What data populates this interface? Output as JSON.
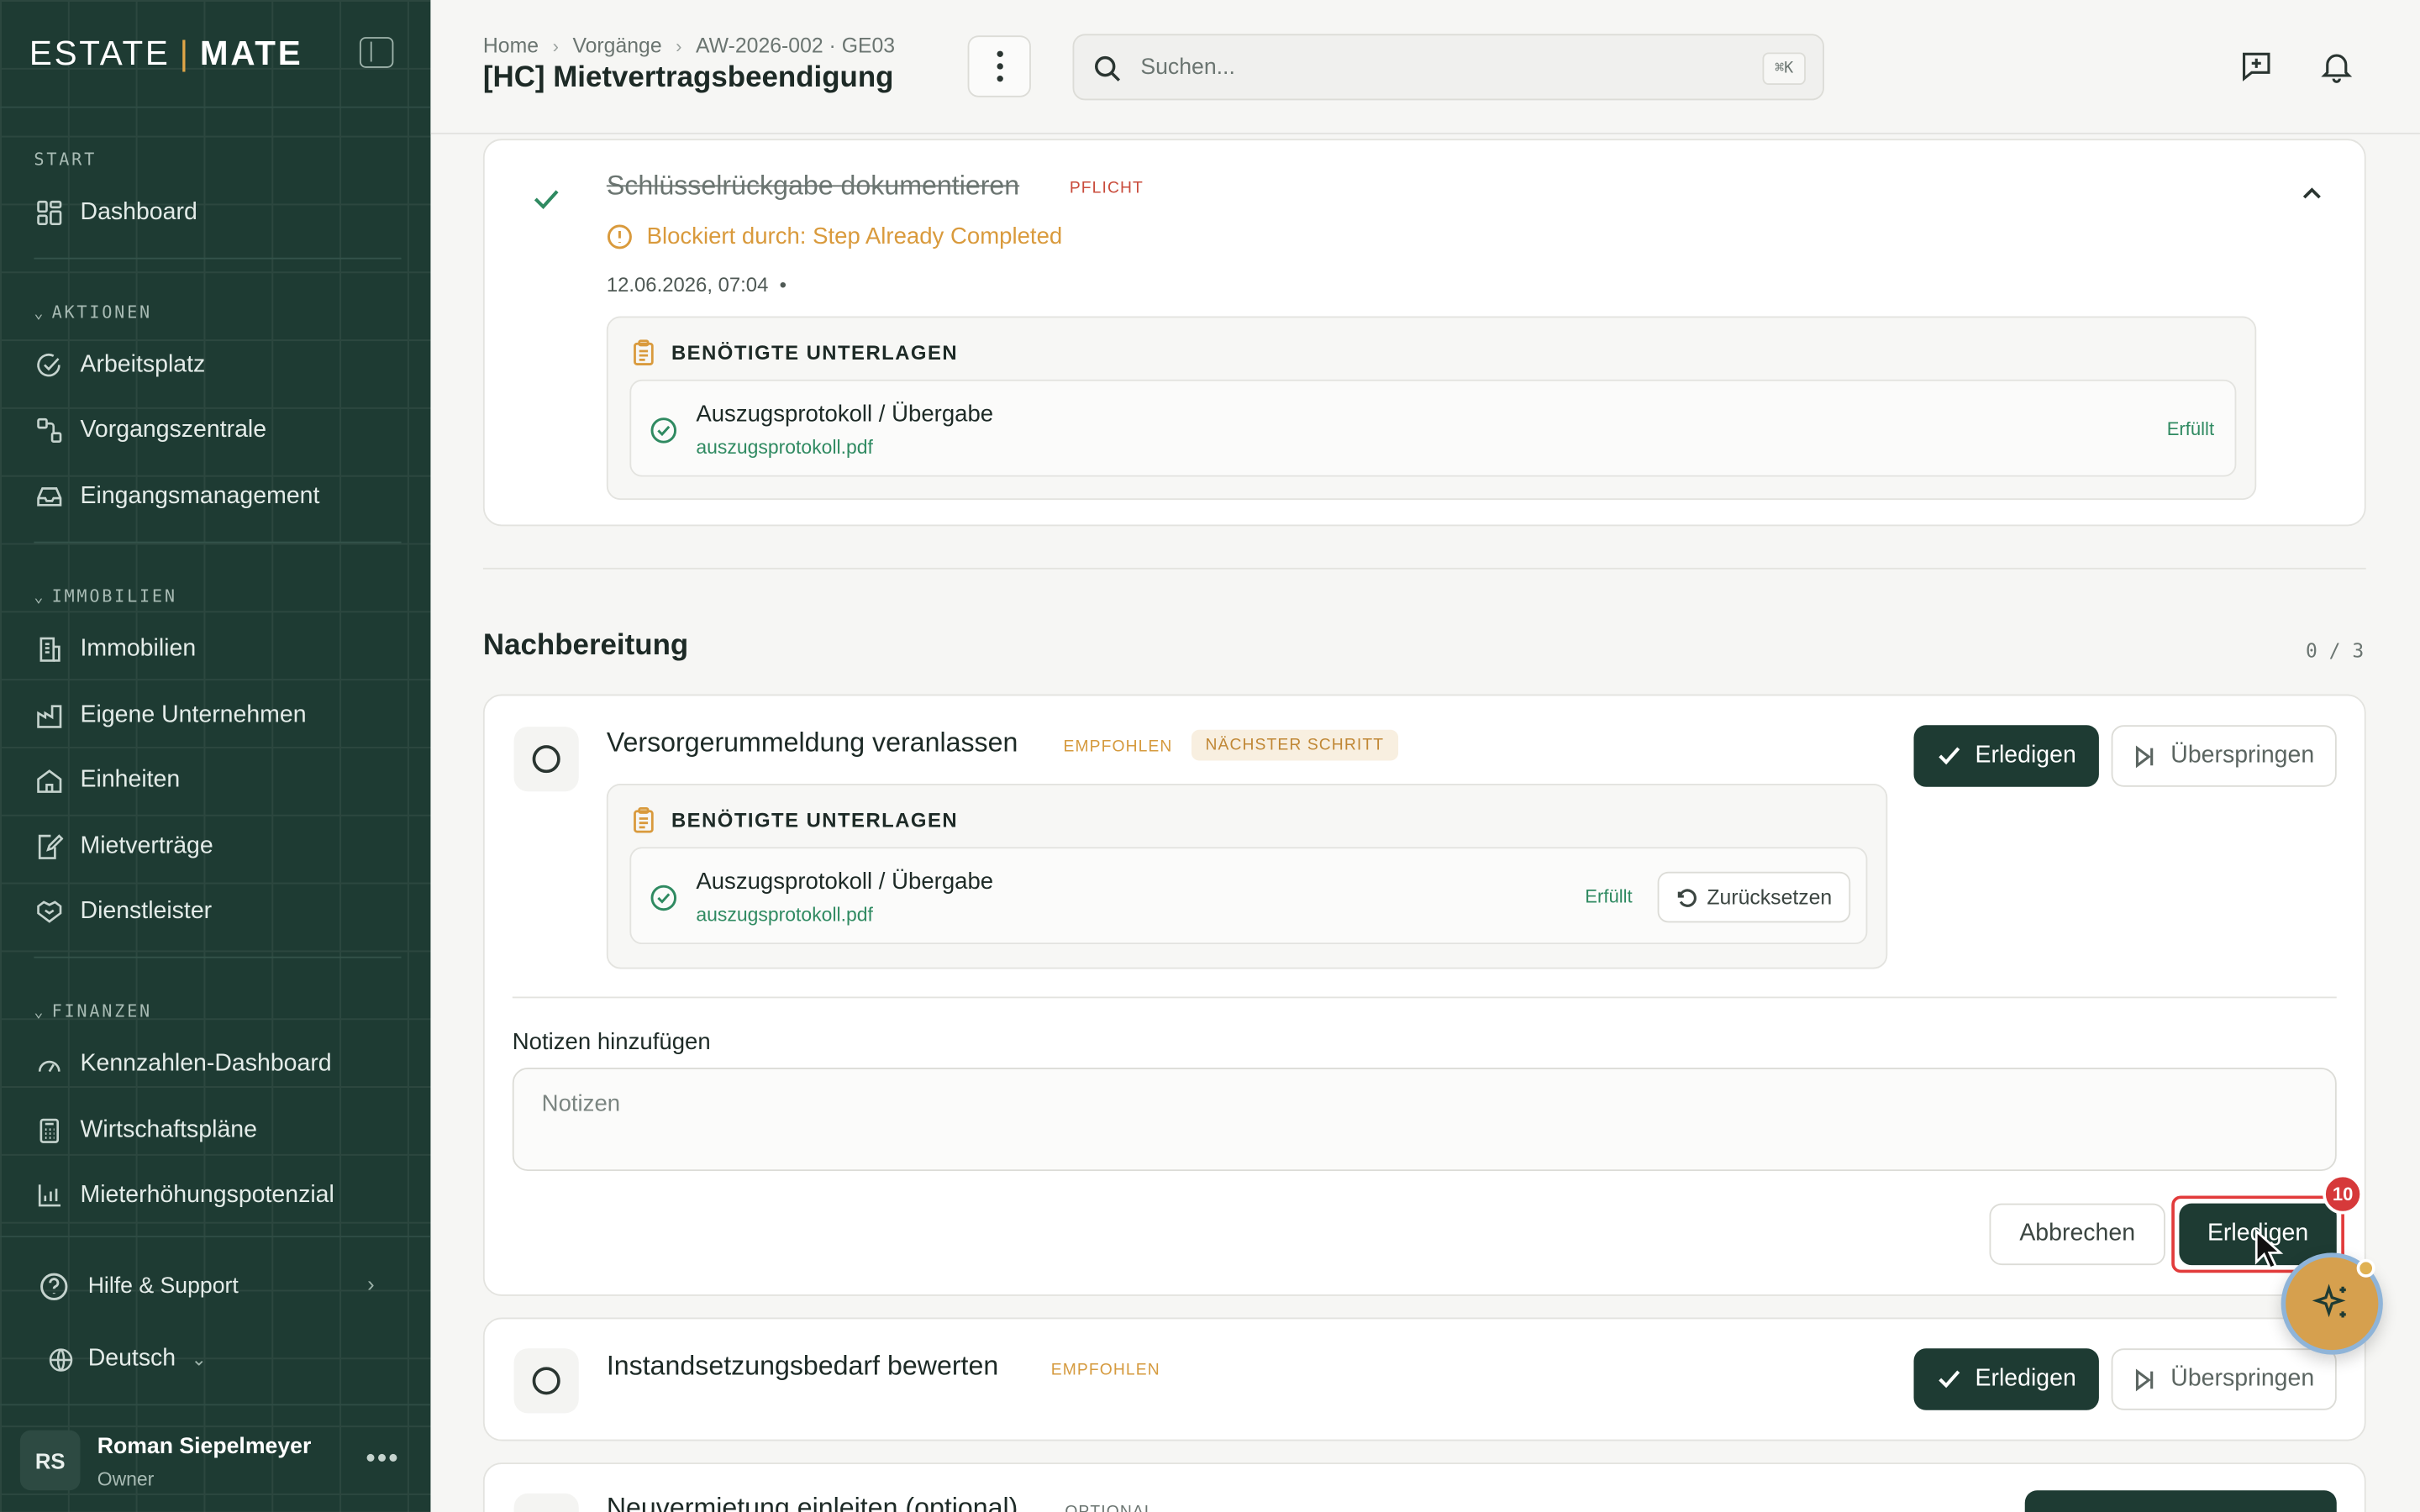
{
  "brand": {
    "part1": "ESTATE",
    "separator": "|",
    "part2": "MATE"
  },
  "sidebar": {
    "sections": [
      {
        "label": "START",
        "items": [
          {
            "label": "Dashboard",
            "icon": "dashboard-icon"
          }
        ]
      },
      {
        "label": "AKTIONEN",
        "items": [
          {
            "label": "Arbeitsplatz",
            "icon": "check-circle-icon"
          },
          {
            "label": "Vorgangszentrale",
            "icon": "workflow-icon"
          },
          {
            "label": "Eingangsmanagement",
            "icon": "inbox-icon"
          }
        ]
      },
      {
        "label": "IMMOBILIEN",
        "items": [
          {
            "label": "Immobilien",
            "icon": "building-icon"
          },
          {
            "label": "Eigene Unternehmen",
            "icon": "factory-icon"
          },
          {
            "label": "Einheiten",
            "icon": "home-icon"
          },
          {
            "label": "Mietverträge",
            "icon": "contract-icon"
          },
          {
            "label": "Dienstleister",
            "icon": "handshake-icon"
          }
        ]
      },
      {
        "label": "FINANZEN",
        "items": [
          {
            "label": "Kennzahlen-Dashboard",
            "icon": "gauge-icon"
          },
          {
            "label": "Wirtschaftspläne",
            "icon": "calculator-icon"
          },
          {
            "label": "Mieterhöhungspotenzial",
            "icon": "bar-chart-icon"
          }
        ]
      }
    ],
    "help_label": "Hilfe & Support",
    "language": "Deutsch",
    "user": {
      "initials": "RS",
      "name": "Roman Siepelmeyer",
      "role": "Owner"
    }
  },
  "header": {
    "breadcrumb": [
      "Home",
      "Vorgänge",
      "AW-2026-002 · GE03"
    ],
    "title": "[HC] Mietvertragsbeendigung",
    "search_placeholder": "Suchen...",
    "search_shortcut": "⌘K"
  },
  "completed_step": {
    "title": "Schlüsselrückgabe dokumentieren",
    "tag": "PFLICHT",
    "blocked_text": "Blockiert durch: Step Already Completed",
    "date": "12.06.2026, 07:04",
    "date_suffix": "•",
    "docs_heading": "BENÖTIGTE UNTERLAGEN",
    "doc": {
      "name": "Auszugsprotokoll / Übergabe",
      "file": "auszugsprotokoll.pdf",
      "status": "Erfüllt"
    }
  },
  "section": {
    "title": "Nachbereitung",
    "count": "0 / 3"
  },
  "steps": [
    {
      "title": "Versorgerummeldung veranlassen",
      "tags": [
        "EMPFOHLEN",
        "NÄCHSTER SCHRITT"
      ],
      "complete_label": "Erledigen",
      "skip_label": "Überspringen",
      "docs_heading": "BENÖTIGTE UNTERLAGEN",
      "doc": {
        "name": "Auszugsprotokoll / Übergabe",
        "file": "auszugsprotokoll.pdf",
        "status": "Erfüllt",
        "reset_label": "Zurücksetzen"
      },
      "notes_label": "Notizen hinzufügen",
      "notes_placeholder": "Notizen",
      "cancel_label": "Abbrechen",
      "confirm_label": "Erledigen",
      "annotation_badge": "10"
    },
    {
      "title": "Instandsetzungsbedarf bewerten",
      "tag": "EMPFOHLEN",
      "complete_label": "Erledigen",
      "skip_label": "Überspringen"
    },
    {
      "title": "Neuvermietung einleiten (optional)",
      "tag": "OPTIONAL"
    }
  ],
  "colors": {
    "sidebar_bg": "#1e3b33",
    "primary": "#1e3b33",
    "accent": "#e0a547",
    "success": "#2f8a61",
    "danger": "#c94b3b",
    "warning": "#d99a3c"
  }
}
